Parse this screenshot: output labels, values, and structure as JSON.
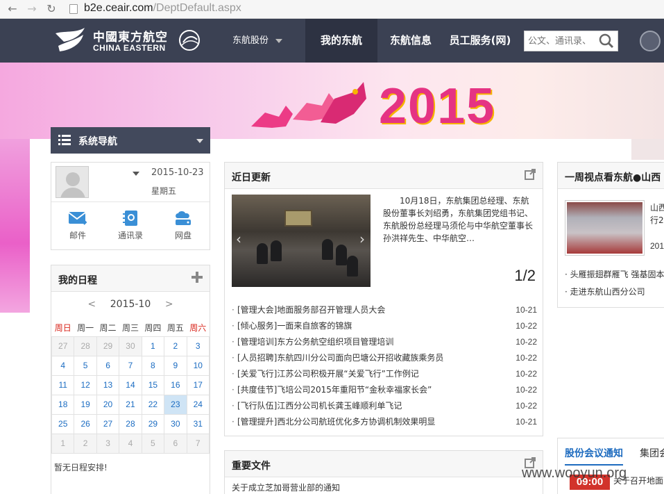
{
  "browser": {
    "url_host": "b2e.ceair.com",
    "url_path": "/DeptDefault.aspx"
  },
  "header": {
    "logo_cn": "中國東方航空",
    "logo_en": "CHINA EASTERN",
    "nav": {
      "group": "东航股份",
      "mine": "我的东航",
      "info": "东航信息",
      "staff": "员工服务(网)"
    },
    "search_placeholder": "公文、通讯录、"
  },
  "banner": {
    "year": "2015"
  },
  "sidebar": {
    "nav_label": "系统导航",
    "profile": {
      "date": "2015-10-23",
      "weekday": "星期五"
    },
    "quick_links": [
      "邮件",
      "通讯录",
      "网盘"
    ],
    "schedule": {
      "title": "我的日程",
      "month": "2015-10",
      "weekdays": [
        "周日",
        "周一",
        "周二",
        "周三",
        "周四",
        "周五",
        "周六"
      ],
      "weeks": [
        [
          "27",
          "28",
          "29",
          "30",
          "1",
          "2",
          "3"
        ],
        [
          "4",
          "5",
          "6",
          "7",
          "8",
          "9",
          "10"
        ],
        [
          "11",
          "12",
          "13",
          "14",
          "15",
          "16",
          "17"
        ],
        [
          "18",
          "19",
          "20",
          "21",
          "22",
          "23",
          "24"
        ],
        [
          "25",
          "26",
          "27",
          "28",
          "29",
          "30",
          "31"
        ],
        [
          "1",
          "2",
          "3",
          "4",
          "5",
          "6",
          "7"
        ]
      ],
      "empty_text": "暂无日程安排!"
    }
  },
  "recent": {
    "title": "近日更新",
    "summary": "10月18日，东航集团总经理、东航股份董事长刘绍勇，东航集团党组书记、东航股份总经理马须伦与中华航空董事长孙洪祥先生、中华航空…",
    "pager": "1/2",
    "items": [
      {
        "title": "[管理大会]地面服务部召开管理人员大会",
        "date": "10-21"
      },
      {
        "title": "[倾心服务]一面来自旅客的锦旗",
        "date": "10-22"
      },
      {
        "title": "[管理培训]东方公务航空组织项目管理培训",
        "date": "10-22"
      },
      {
        "title": "[人员招聘]东航四川分公司面向巴塘公开招收藏族乘务员",
        "date": "10-22"
      },
      {
        "title": "[关爱飞行]江苏公司积极开展“关爱飞行”工作例记",
        "date": "10-22"
      },
      {
        "title": "[共度佳节]飞培公司2015年重阳节“金秋幸福家长会”",
        "date": "10-22"
      },
      {
        "title": "[飞行队伍]江西分公司机长龚玉峰顺利单飞记",
        "date": "10-22"
      },
      {
        "title": "[管理提升]西北分公司航班优化多方协调机制效果明显",
        "date": "10-21"
      }
    ]
  },
  "docs": {
    "title": "重要文件",
    "first_item": "关于成立芝加哥营业部的通知"
  },
  "weekly": {
    "title": "一周视点看东航●山西",
    "text1": "山西",
    "text2": "行2",
    "text3": "201",
    "links": [
      "头雁振翅群雁飞 强基固本",
      "走进东航山西分公司"
    ]
  },
  "meeting": {
    "tab_active": "股份会议通知",
    "tab_other": "集团会",
    "time": "09:00",
    "text": "关于召开地面"
  },
  "watermark": "www.wooyun.org",
  "colors": {
    "header_bg": "#3b4153",
    "accent_blue": "#1d6bbf",
    "weekend_red": "#d9261c",
    "banner_pink": "#e53383"
  }
}
